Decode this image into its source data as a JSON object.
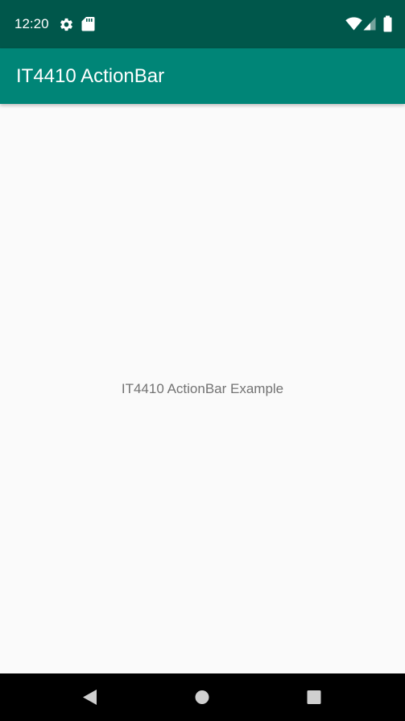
{
  "status_bar": {
    "time": "12:20",
    "background": "#00574b",
    "icons": [
      "gear-icon",
      "sd-card-icon",
      "wifi-icon",
      "signal-icon",
      "battery-icon"
    ]
  },
  "action_bar": {
    "title": "IT4410 ActionBar",
    "background": "#008577"
  },
  "content": {
    "message": "IT4410 ActionBar Example"
  },
  "nav_bar": {
    "buttons": [
      "back-icon",
      "home-icon",
      "recents-icon"
    ]
  }
}
